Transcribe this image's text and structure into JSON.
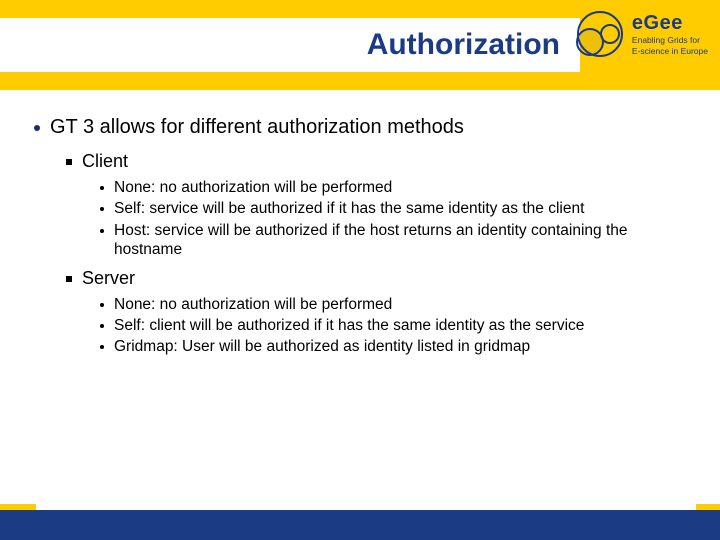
{
  "header": {
    "title": "Authorization",
    "logo_abbr": "eGee",
    "logo_tag1": "Enabling Grids for",
    "logo_tag2": "E-science in Europe"
  },
  "content": {
    "l1": "GT 3 allows for different authorization methods",
    "client": {
      "heading": "Client",
      "items": [
        "None: no authorization will be performed",
        "Self: service will be authorized if it has the same identity as the client",
        "Host: service will be authorized if the host returns an identity containing the hostname"
      ]
    },
    "server": {
      "heading": "Server",
      "items": [
        "None: no authorization will be performed",
        "Self:  client will be authorized if it has the same identity as the service",
        "Gridmap: User will be authorized as identity listed in gridmap"
      ]
    }
  }
}
